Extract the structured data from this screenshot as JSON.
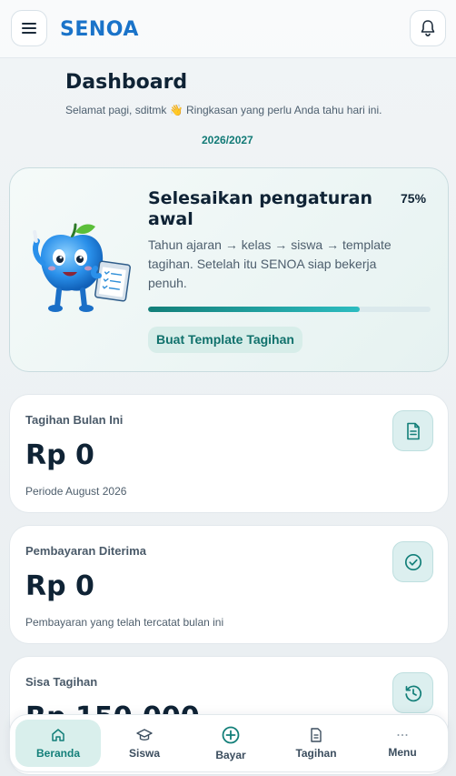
{
  "header": {
    "brand": "SENOA",
    "menu_icon": "hamburger-icon",
    "notification_icon": "bell-icon"
  },
  "page": {
    "title": "Dashboard",
    "greeting": "Selamat pagi, sditmk 👋 Ringkasan yang perlu Anda tahu hari ini.",
    "academic_year": "2026/2027"
  },
  "setup": {
    "title": "Selesaikan pengaturan awal",
    "percent_label": "75%",
    "progress": 0.75,
    "description": "Tahun ajaran → kelas → siswa → template tagihan. Setelah itu SENOA siap bekerja penuh.",
    "button_label": "Buat Template Tagihan",
    "mascot": "apple-mascot-with-clipboard"
  },
  "stats": [
    {
      "label": "Tagihan Bulan Ini",
      "value": "Rp 0",
      "note": "Periode August 2026",
      "icon": "invoice-icon"
    },
    {
      "label": "Pembayaran Diterima",
      "value": "Rp 0",
      "note": "Pembayaran yang telah tercatat bulan ini",
      "icon": "check-circle-icon"
    },
    {
      "label": "Sisa Tagihan",
      "value": "Rp 150.000",
      "note": "",
      "icon": "history-icon"
    }
  ],
  "nav": [
    {
      "label": "Beranda",
      "icon": "home-icon",
      "active": true
    },
    {
      "label": "Siswa",
      "icon": "graduation-cap-icon",
      "active": false
    },
    {
      "label": "Bayar",
      "icon": "plus-circle-icon",
      "active": false
    },
    {
      "label": "Tagihan",
      "icon": "document-icon",
      "active": false
    },
    {
      "label": "Menu",
      "icon": "more-icon",
      "active": false
    }
  ],
  "colors": {
    "accent": "#137f79",
    "brand": "#1a73c9",
    "text": "#0f2335"
  }
}
